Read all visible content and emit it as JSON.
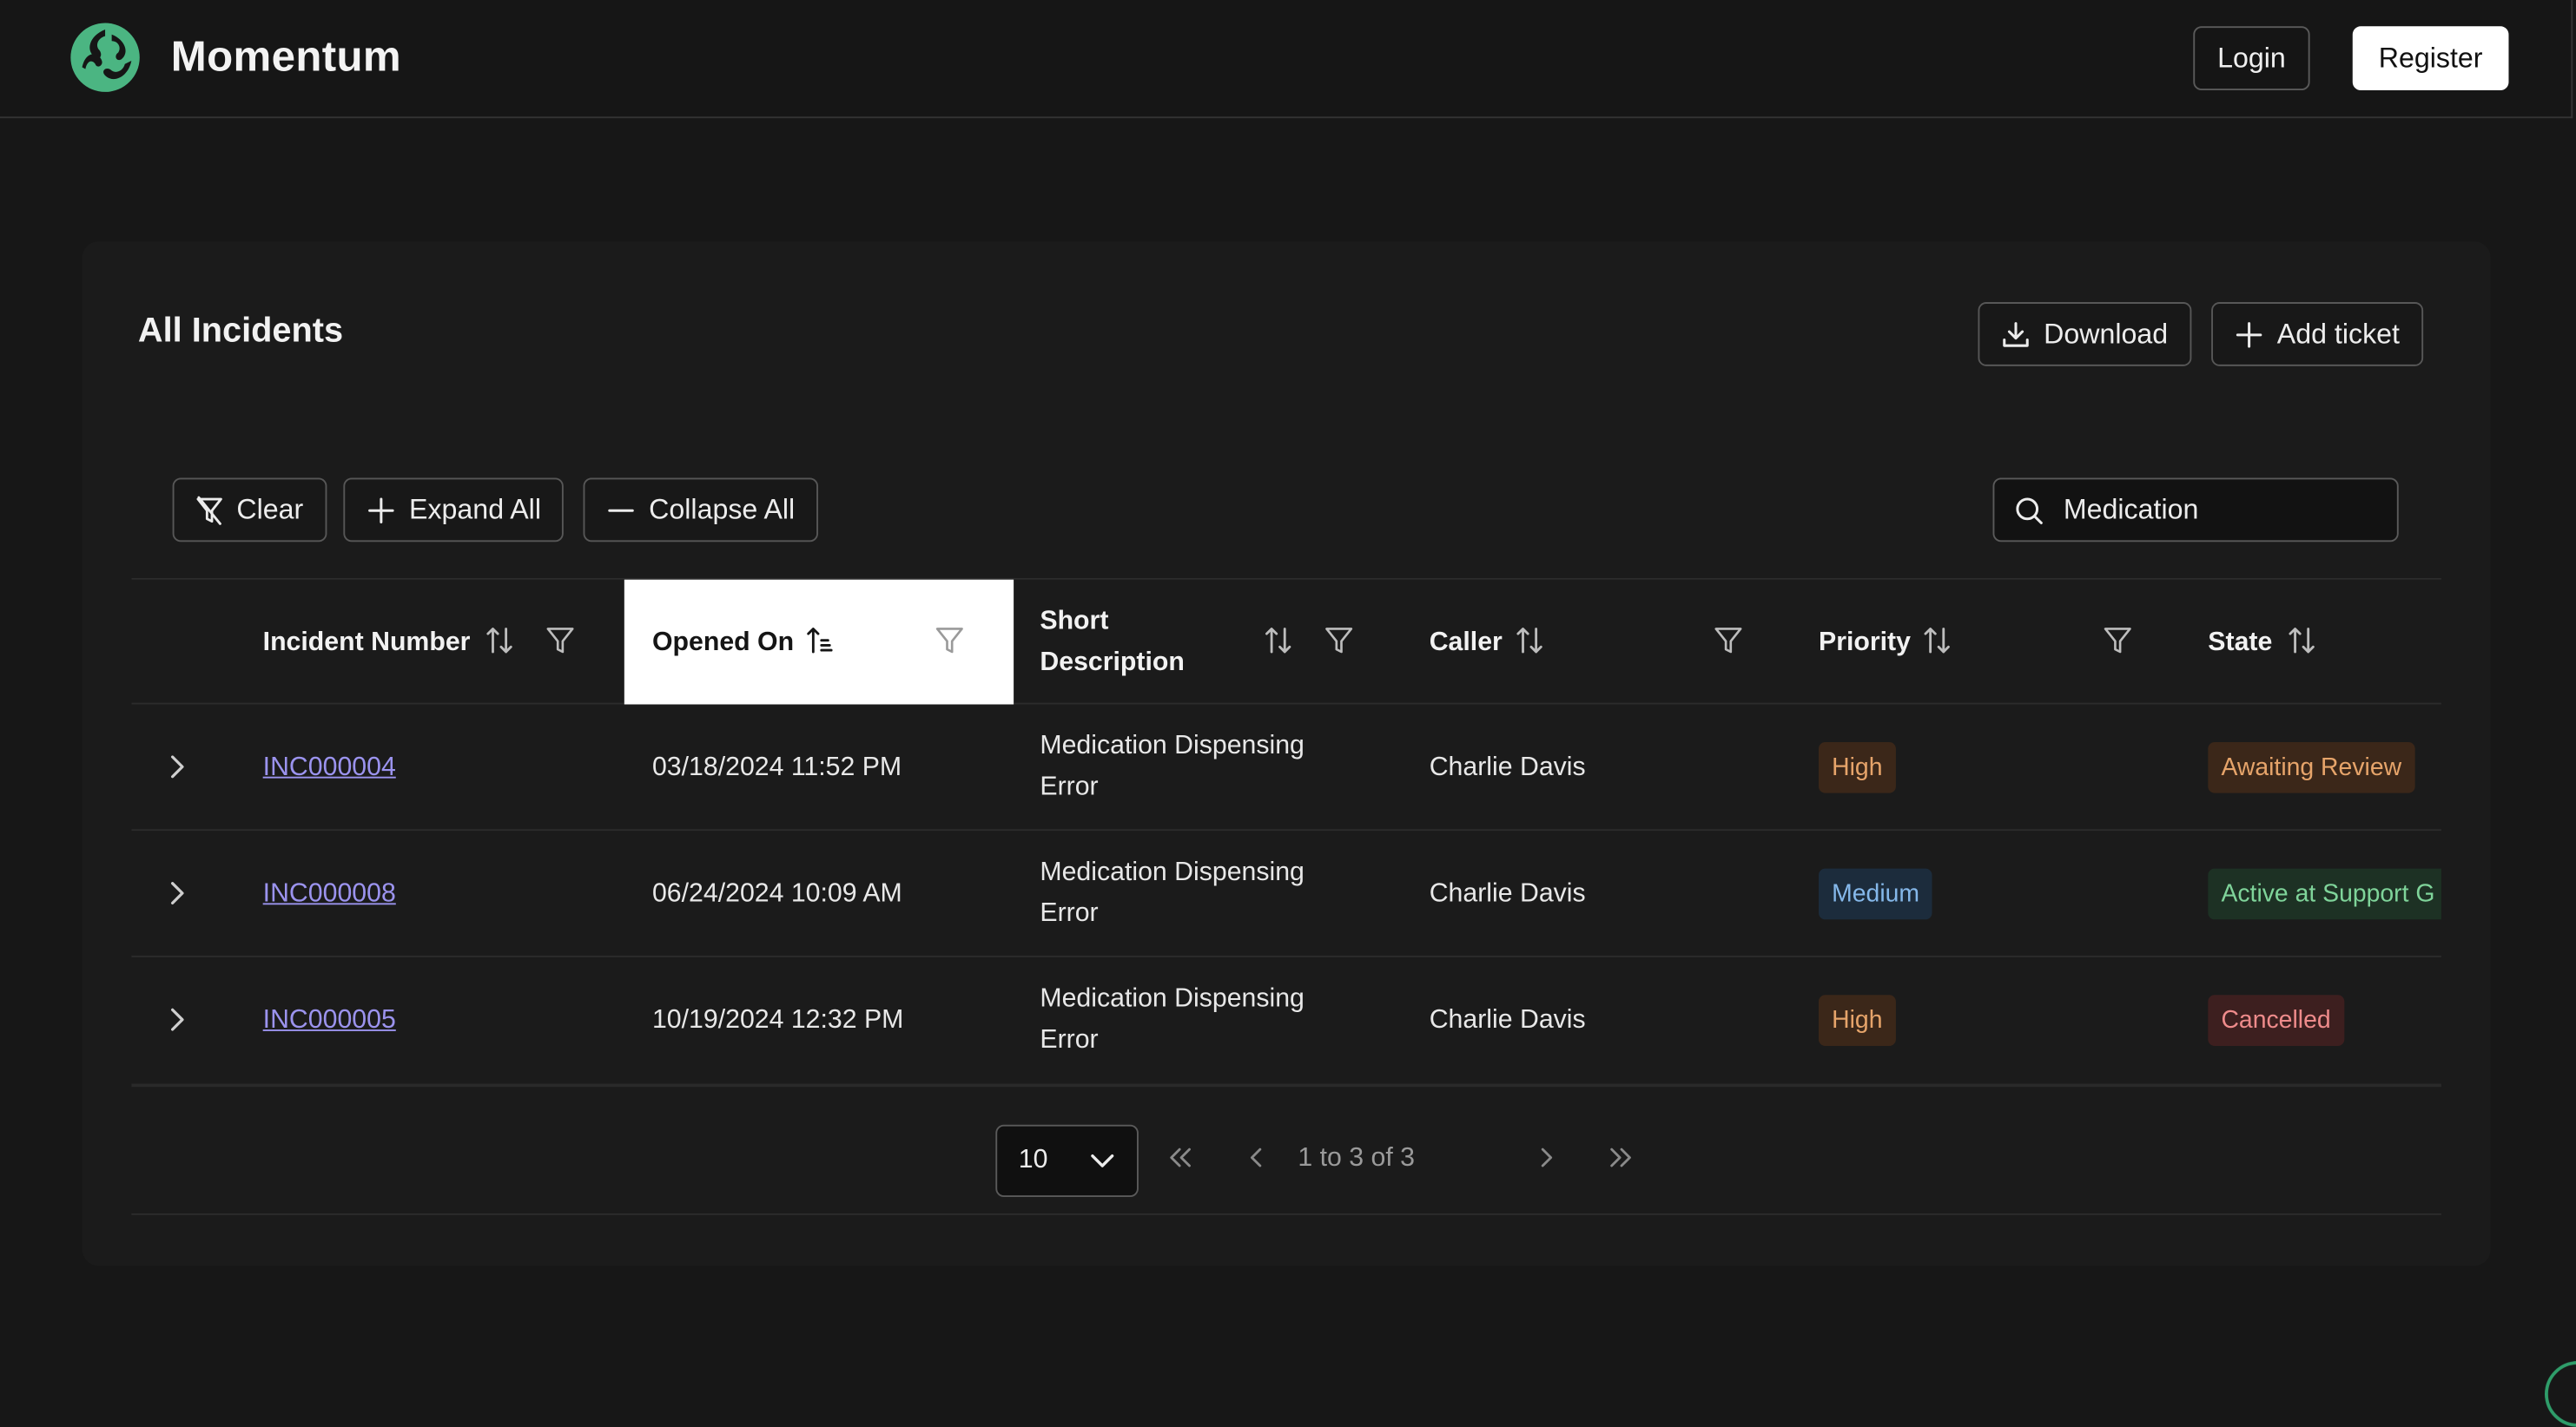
{
  "header": {
    "brand": "Momentum",
    "login_label": "Login",
    "register_label": "Register"
  },
  "card": {
    "title": "All Incidents",
    "download_label": "Download",
    "add_ticket_label": "Add ticket",
    "clear_label": "Clear",
    "expand_all_label": "Expand All",
    "collapse_all_label": "Collapse All",
    "search_value": "Medication"
  },
  "table": {
    "columns": [
      {
        "label": "Incident Number"
      },
      {
        "label": "Opened On"
      },
      {
        "label": "Short Description"
      },
      {
        "label": "Caller"
      },
      {
        "label": "Priority"
      },
      {
        "label": "State"
      }
    ],
    "rows": [
      {
        "incident": "INC000004",
        "opened_on": "03/18/2024 11:52 PM",
        "description": "Medication Dispensing Error",
        "caller": "Charlie Davis",
        "priority": "High",
        "state": "Awaiting Review"
      },
      {
        "incident": "INC000008",
        "opened_on": "06/24/2024 10:09 AM",
        "description": "Medication Dispensing Error",
        "caller": "Charlie Davis",
        "priority": "Medium",
        "state": "Active at Support G"
      },
      {
        "incident": "INC000005",
        "opened_on": "10/19/2024 12:32 PM",
        "description": "Medication Dispensing Error",
        "caller": "Charlie Davis",
        "priority": "High",
        "state": "Cancelled"
      }
    ],
    "horizontal_scroll_fraction": 0.48
  },
  "pagination": {
    "page_size": "10",
    "info": "1 to 3 of 3"
  },
  "colors": {
    "background": "#171717",
    "card": "#1b1b1b",
    "link": "#9b93ee",
    "brand_green": "#4bb582",
    "badge_high_bg": "#3b2719",
    "badge_high_fg": "#e6a46a",
    "badge_medium_bg": "#1c2c3c",
    "badge_medium_fg": "#85b8ea",
    "badge_review_bg": "#3b2719",
    "badge_review_fg": "#e6a46a",
    "badge_active_bg": "#1d3124",
    "badge_active_fg": "#7fd49a",
    "badge_cancelled_bg": "#3d1f1f",
    "badge_cancelled_fg": "#ee8b8b"
  }
}
